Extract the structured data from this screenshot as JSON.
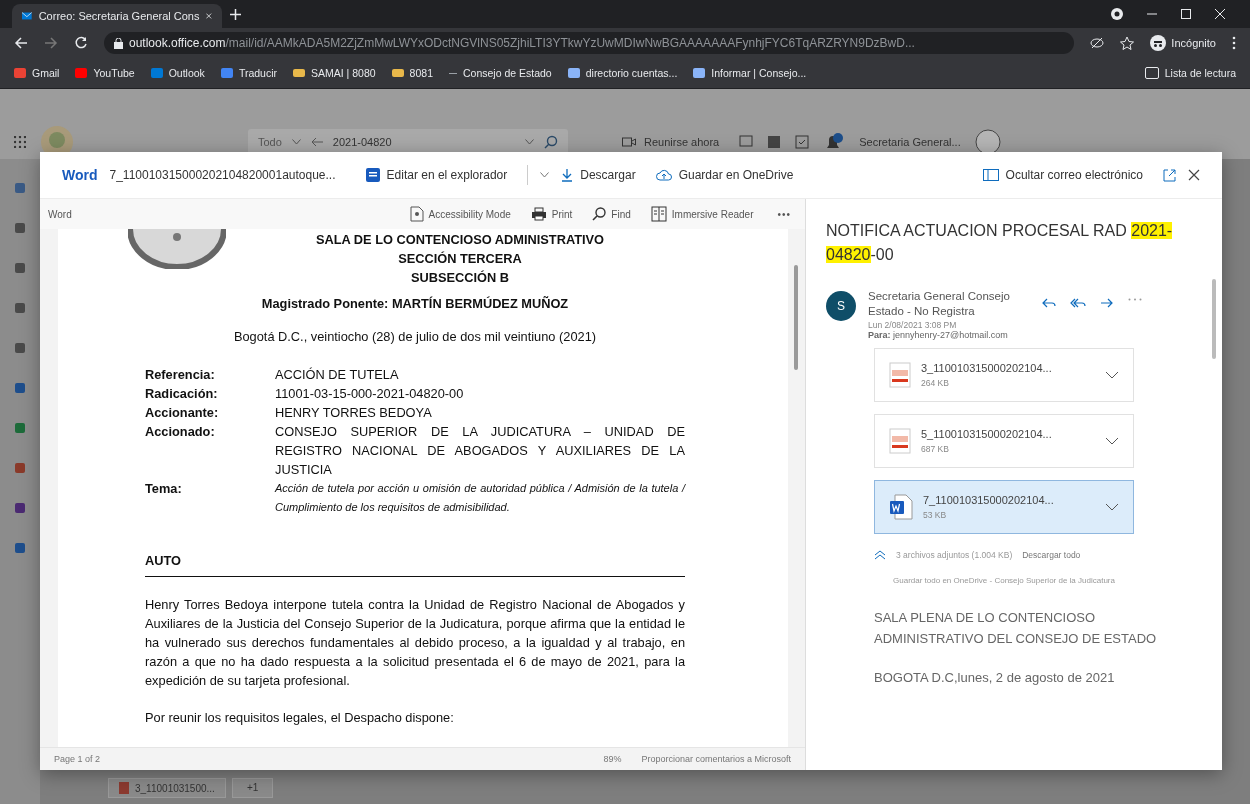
{
  "browser": {
    "tabs": [
      {
        "title": "Correo: Secretaria General Cons",
        "selected": true
      }
    ],
    "url": {
      "host": "outlook.office.com",
      "path": "/mail/id/AAMkADA5M2ZjZmMwLWYxODctNGVlNS05ZjhiLTI3YTkwYzUwMDIwNwBGAAAAAAAFynhjFYC6TqARZRYN9DzBwD..."
    },
    "profile": "Incógnito",
    "bookmarks": [
      {
        "label": "Gmail",
        "kind": "gmail"
      },
      {
        "label": "YouTube",
        "kind": "youtube"
      },
      {
        "label": "Outlook",
        "kind": "outlook"
      },
      {
        "label": "Traducir",
        "kind": "translate"
      },
      {
        "label": "SAMAI | 8080",
        "kind": "folder"
      },
      {
        "label": "8081",
        "kind": "folder"
      },
      {
        "label": "Consejo de Estado",
        "kind": "dash"
      },
      {
        "label": "directorio cuentas...",
        "kind": "doc"
      },
      {
        "label": "Informar | Consejo...",
        "kind": "doc"
      }
    ],
    "reading_list": "Lista de lectura"
  },
  "outlook": {
    "search_scope": "Todo",
    "search_value": "2021-04820",
    "meet": "Reunirse ahora",
    "account": "Secretaria General...",
    "attachment_chip": {
      "name": "3_11001031500...",
      "more": "+1"
    }
  },
  "viewer": {
    "app": "Word",
    "file_name": "7_110010315000202104820001autoque...",
    "actions": [
      {
        "label": "Editar en el explorador",
        "kind": "edit"
      },
      {
        "label": "Descargar",
        "kind": "download"
      },
      {
        "label": "Guardar en OneDrive",
        "kind": "cloud"
      }
    ],
    "hide_mail": "Ocultar correo electrónico",
    "doc_toolbar": {
      "label": "Word",
      "buttons": [
        {
          "label": "Accessibility Mode",
          "kind": "accessibility"
        },
        {
          "label": "Print",
          "kind": "print"
        },
        {
          "label": "Find",
          "kind": "find"
        },
        {
          "label": "Immersive Reader",
          "kind": "reader"
        }
      ],
      "more": "•••"
    },
    "document": {
      "heading_lines": [
        "SALA DE LO CONTENCIOSO ADMINISTRATIVO",
        "SECCIÓN TERCERA",
        "SUBSECCIÓN B"
      ],
      "ponente": "Magistrado Ponente: MARTÍN BERMÚDEZ MUÑOZ",
      "date": "Bogotá D.C., veintiocho (28) de julio de dos mil veintiuno (2021)",
      "fields": [
        {
          "label": "Referencia:",
          "value": "ACCIÓN DE TUTELA",
          "kind": "plain"
        },
        {
          "label": "Radicación:",
          "value": "11001-03-15-000-2021-04820-00",
          "kind": "plain"
        },
        {
          "label": "Accionante:",
          "value": "HENRY TORRES BEDOYA",
          "kind": "plain"
        },
        {
          "label": "Accionado:",
          "value": "CONSEJO SUPERIOR DE LA JUDICATURA – UNIDAD DE REGISTRO NACIONAL DE ABOGADOS Y AUXILIARES DE LA JUSTICIA",
          "kind": "plain"
        },
        {
          "label": "Tema:",
          "value": "Acción de tutela por acción u omisión de autoridad pública / Admisión de la tutela / Cumplimiento de los requisitos de admisibilidad.",
          "kind": "italic"
        }
      ],
      "section": "AUTO",
      "paragraphs": [
        "Henry Torres Bedoya interpone tutela contra la Unidad de Registro Nacional de Abogados y Auxiliares de la Justicia del Consejo Superior de la Judicatura, porque afirma que la entidad le ha vulnerado sus derechos fundamentales al debido proceso, a la igualdad y al trabajo, en razón a que no ha dado respuesta a la solicitud presentada el 6 de mayo de 2021, para la expedición de su tarjeta profesional.",
        "Por reunir los requisitos legales, el Despacho dispone:"
      ]
    },
    "status": {
      "page": "Page 1 of 2",
      "zoom": "89%",
      "feedback": "Proporcionar comentarios a Microsoft"
    }
  },
  "email": {
    "subject": [
      {
        "text": "NOTIFICA ACTUACION PROCESAL RAD ",
        "highlighted": false
      },
      {
        "text": "2021-04820",
        "highlighted": true
      },
      {
        "text": "-00",
        "highlighted": false
      }
    ],
    "avatar": "S",
    "sender": "Secretaria General Consejo Estado - No Registra",
    "date": "Lun 2/08/2021 3:08 PM",
    "to_label": "Para:",
    "to": "jennyhenry-27@hotmail.com",
    "attachments": [
      {
        "name": "3_110010315000202104...",
        "size": "264 KB",
        "kind": "pdf",
        "selected": false
      },
      {
        "name": "5_110010315000202104...",
        "size": "687 KB",
        "kind": "pdf",
        "selected": false
      },
      {
        "name": "7_110010315000202104...",
        "size": "53 KB",
        "kind": "word",
        "selected": true
      }
    ],
    "summary": "3 archivos adjuntos (1.004 KB)",
    "download_all": "Descargar todo",
    "save_all": "Guardar todo en OneDrive - Consejo Superior de la Judicatura",
    "body": [
      "SALA PLENA DE LO CONTENCIOSO ADMINISTRATIVO DEL CONSEJO DE ESTADO",
      "BOGOTA D.C,lunes, 2 de agosto de 2021"
    ]
  }
}
